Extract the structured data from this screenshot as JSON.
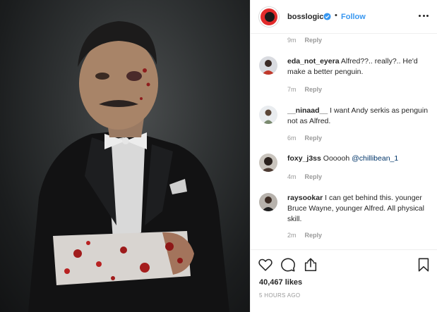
{
  "post": {
    "username": "bosslogic",
    "follow_label": "Follow",
    "separator": "•",
    "likes": "40,467 likes",
    "timestamp": "5 HOURS AGO"
  },
  "comments": {
    "top_time": "9m",
    "reply_label": "Reply",
    "items": [
      {
        "user": "eda_not_eyera",
        "text": "Alfred??.. really?.. He'd make a better penguin.",
        "time": "7m"
      },
      {
        "user": "__ninaad__",
        "text": "I want Andy serkis as penguin not as Alfred.",
        "time": "6m"
      },
      {
        "user": "foxy_j3ss",
        "text": "Oooooh ",
        "mention": "@chillibean_1",
        "time": "4m"
      },
      {
        "user": "raysookar",
        "text": "I can get behind this. younger Bruce Wayne, younger Alfred. All physical skill.",
        "time": "2m"
      }
    ]
  },
  "icons": {
    "like": "heart-icon",
    "comment": "comment-icon",
    "share": "share-icon",
    "save": "bookmark-icon",
    "verified": "verified-badge-icon",
    "more": "more-options-icon"
  },
  "colors": {
    "link": "#3897f0",
    "text": "#262626",
    "muted": "#999999",
    "border": "#efefef",
    "avatar_ring": "#e22b2b"
  }
}
